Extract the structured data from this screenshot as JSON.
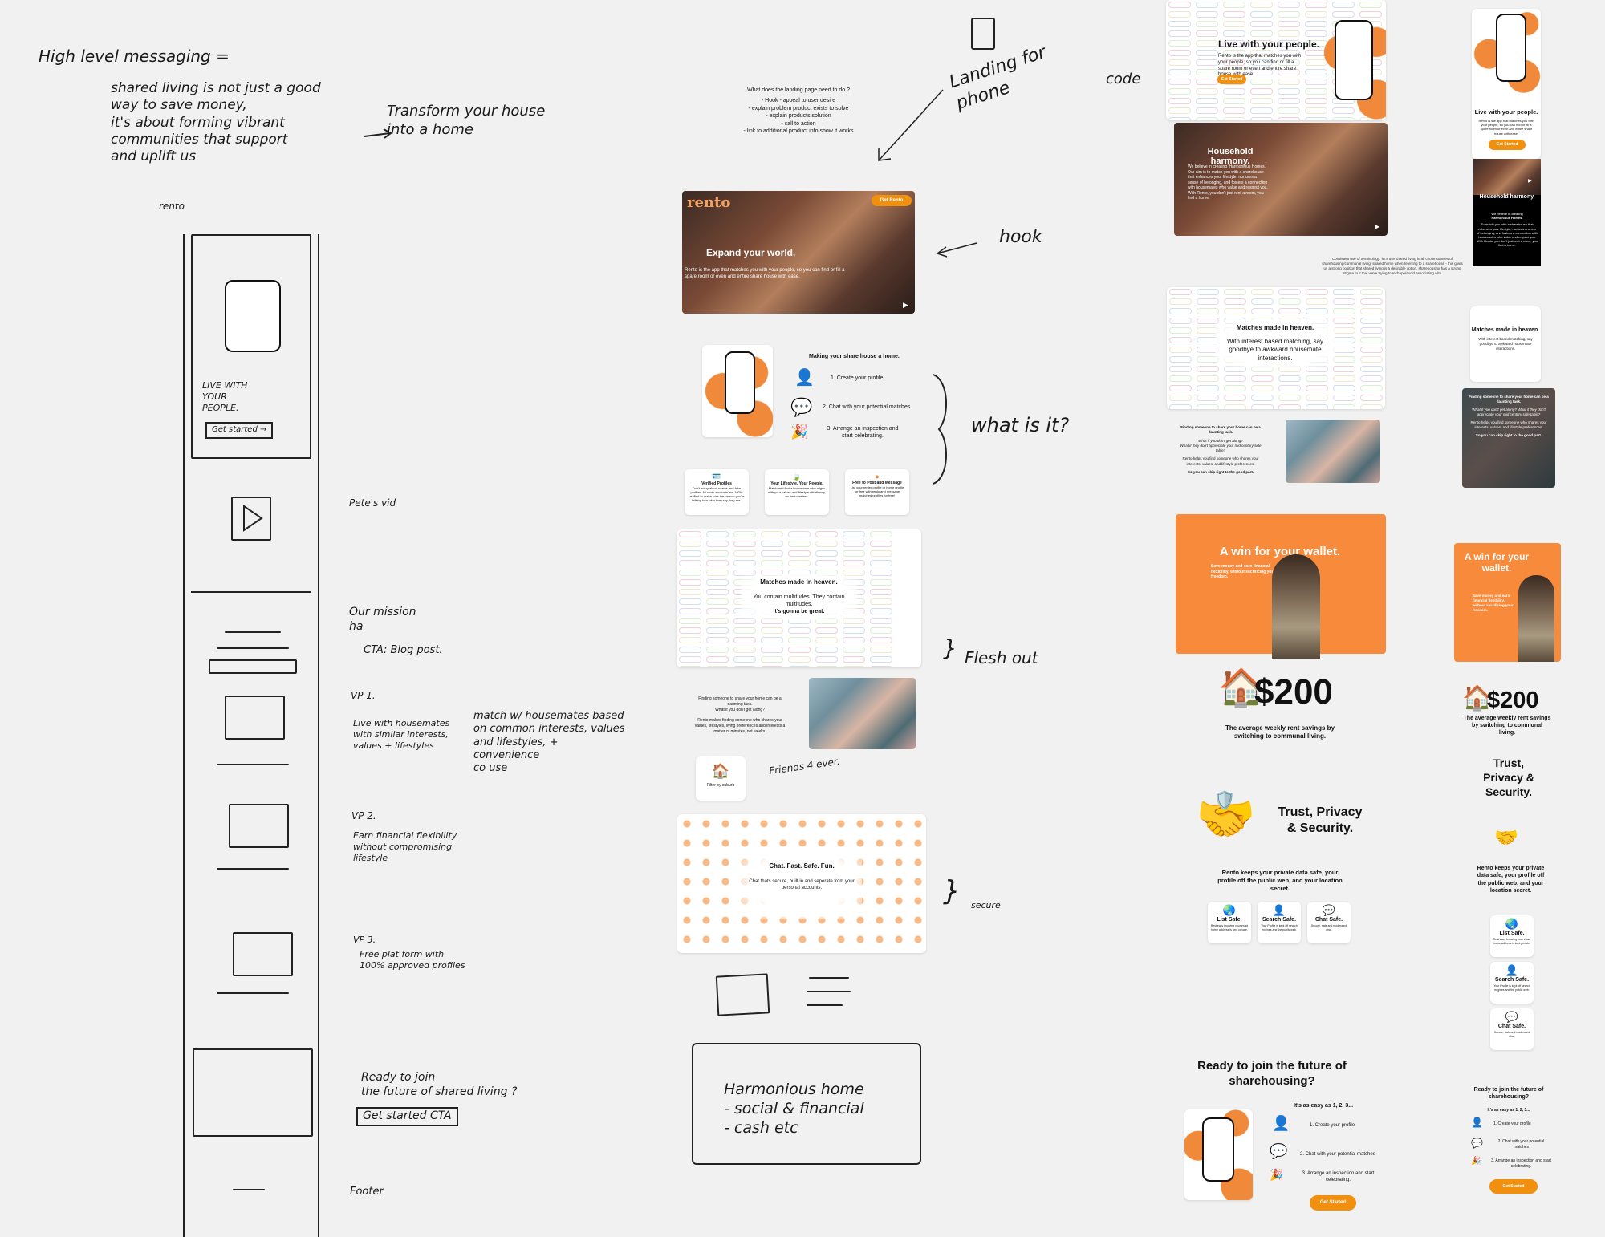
{
  "notes": {
    "top_left_heading": "High level messaging =",
    "top_left_body": "shared living is not just a good\nway to save money,\nit's about forming vibrant\ncommunities that support\nand uplift us",
    "transform": "Transform your house\ninto a home",
    "rento_label": "rento",
    "landing_for_phone": "Landing for\nphone",
    "code": "code",
    "hook": "hook",
    "what_is_it": "what is it?",
    "flesh_out": "Flesh out",
    "secure": "secure",
    "friends_4_ever": "Friends 4 ever.",
    "petes_vid": "Pete's vid",
    "our_mission": "Our mission\nha",
    "cta_blog": "CTA: Blog post.",
    "vp1_title": "VP 1.",
    "vp1_body": "Live with housemates\nwith similar interests,\nvalues + lifestyles",
    "vp1_side": "match w/ housemates based\non common interests, values\nand lifestyles, +\nconvenience\nco   use",
    "vp2_title": "VP 2.",
    "vp2_body": "Earn financial flexibility\nwithout compromising\nlifestyle",
    "vp3_title": "VP 3.",
    "vp3_body": "Free plat form with\n100% approved profiles",
    "ready_note": "Ready to join\nthe future of shared living ?",
    "get_started_cta_note": "Get started CTA",
    "footer_note": "Footer",
    "harmonious": "Harmonious home\n- social & financial\n- cash etc",
    "sketch_live": "LIVE WITH\nYOUR\nPEOPLE.",
    "sketch_get_started": "Get started →"
  },
  "requirements": {
    "title": "What does the landing page need to do ?",
    "items": [
      "- Hook - appeal to user desire",
      "- explain problem product exists to solve",
      "- explain products solution",
      "- call to action",
      "- link to additional product info show it works"
    ]
  },
  "terminology_note": "Consistent use of terminology: let's use shared living in all circumstances of sharehousing/communal living, shared home when referring to a sharehouse - this gives us a strong position that shared living is a desirable option, sharehousing has a strong stigma to it that we're trying to reshape/avoid associating with",
  "draft_v1": {
    "logo": "rento",
    "cta": "Get Rento",
    "hero_title": "Expand your world.",
    "hero_body": "Rento is the app that matches you with your people, so you can find or fill a spare room or even and entire share house with ease.",
    "steps_title": "Making your share house a home.",
    "steps": [
      "1. Create your profile",
      "2. Chat with your potential matches",
      "3. Arrange an inspection and start celebrating."
    ],
    "features": [
      {
        "title": "Verified Profiles",
        "body": "Don't worry about scams and fake profiles. All rento accounts are 100% verified to make sure the person you're talking to is who they say they are."
      },
      {
        "title": "Your Lifestyle, Your People.",
        "body": "Match and find a housemate who aligns with your values and lifestyle effortlessly, no time wasters."
      },
      {
        "title": "Free to Post and Message",
        "body": "List your renter profile or home profile for free with rento and message matched profiles for free!"
      }
    ],
    "matches_title": "Matches made in heaven.",
    "matches_body": "You contain multitudes. They contain multitudes.",
    "matches_bold": "It's gonna be great.",
    "finding_body": "Finding someone to share your home can be a daunting task.\nWhat if you don't get along?\n\nRento makes finding someone who shares your values, lifestyles, living preferences and interests a matter of minutes, not weeks.",
    "filter_label": "Filter by suburb",
    "chat_title": "Chat. Fast. Safe. Fun.",
    "chat_body": "Chat thats secure, built in and seperate from your personal accounts."
  },
  "desktop_final": {
    "hero_title": "Live with your people.",
    "hero_body": "Rento is the app that matches you with your people, so you can find or fill a spare room or even and entire share house with ease.",
    "hero_cta": "Get Started",
    "harmony_title": "Household harmony.",
    "harmony_body": "We believe in creating 'Harmonious Homes.' Our aim is to match you with a sharehouse that enhances your lifestyle, nurtures a sense of belonging, and fosters a connection with housemates who value and respect you. With Rento, you don't just rent a room, you find a home.",
    "matches_title": "Matches made in heaven.",
    "matches_body": "With interest based matching, say goodbye to awkward housemate interactions.",
    "finding_bold": "Finding someone to share your home can be a daunting task.",
    "finding_italic": "What if you don't get along?\nWhat if they don't appreciate your mid century side table?",
    "finding_body": "Rento helps you find someone who shares your interests, values, and lifestyle preferences.",
    "finding_end": "So you can skip right to the good part.",
    "wallet_title": "A win for your wallet.",
    "wallet_body": "Save money and earn financial flexibility, without sacrificing your freedom.",
    "savings_amount": "$200",
    "savings_caption": "The average weekly rent savings by switching to communal living.",
    "trust_title": "Trust, Privacy & Security.",
    "trust_body": "Rento keeps your private data safe, your profile off the public web, and your location secret.",
    "safe_cards": [
      {
        "icon": "globe-icon",
        "glyph": "🌏",
        "title": "List Safe.",
        "body": "Rest easy knowing your exact home address is kept private."
      },
      {
        "icon": "person-silhouette-icon",
        "glyph": "👤",
        "title": "Search Safe.",
        "body": "Your Profile is kept off search engines and the public web."
      },
      {
        "icon": "speech-bubble-icon",
        "glyph": "💬",
        "title": "Chat Safe.",
        "body": "Secure, safe and moderated chat."
      }
    ],
    "ready_title": "Ready to join the future of sharehousing?",
    "easy_title": "It's as easy as 1, 2, 3...",
    "steps": [
      "1. Create your profile",
      "2. Chat with your potential matches",
      "3. Arrange an inspection and start celebrating."
    ],
    "final_cta": "Get Started"
  },
  "mobile_final": {
    "hero_title": "Live with your people.",
    "hero_body": "Rento is the app that matches you with your people, so you can find or fill a spare room or even and entire share house with ease.",
    "hero_cta": "Get Started",
    "harmony_title": "Household harmony.",
    "harmony_lead": "We believe in creating",
    "harmony_lead_bold": "Harmonious Homes.",
    "harmony_body": "To match you with a sharehouse that enhances your lifestyle, nurtures a sense of belonging, and fosters a connection with housemates who value and respect you. With Rento, you don't just rent a room, you find a home.",
    "matches_title": "Matches made in heaven.",
    "matches_body": "With interest based matching, say goodbye to awkward housemate interactions.",
    "finding_bold": "Finding someone to share your home can be a daunting task.",
    "finding_italic": "What if you don't get along? What if they don't appreciate your mid century side table?",
    "finding_body": "Rento helps you find someone who shares your interests, values, and lifestyle preferences.",
    "finding_end": "So you can skip right to the good part.",
    "wallet_title": "A win for your wallet.",
    "wallet_body": "Save money and earn financial flexibility, without sacrificing your freedom.",
    "savings_amount": "$200",
    "savings_caption": "The average weekly rent savings by switching to communal living.",
    "trust_title": "Trust, Privacy & Security.",
    "trust_body": "Rento keeps your private data safe, your profile off the public web, and your location secret.",
    "safe_cards": [
      {
        "glyph": "🌏",
        "title": "List Safe.",
        "body": "Rest easy knowing your exact home address is kept private."
      },
      {
        "glyph": "👤",
        "title": "Search Safe.",
        "body": "Your Profile is kept off search engines and the public web."
      },
      {
        "glyph": "💬",
        "title": "Chat Safe.",
        "body": "Secure, safe and moderated chat."
      }
    ],
    "ready_title": "Ready to join the future of sharehousing?",
    "easy_title": "It's as easy as 1, 2, 3...",
    "steps": [
      "1. Create your profile",
      "2. Chat with your potential matches",
      "3. Arrange an inspection and start celebrating."
    ],
    "final_cta": "Get Started"
  },
  "colors": {
    "accent": "#f0900e",
    "orange_bg": "#f28a38",
    "canvas": "#f1f1f1"
  }
}
